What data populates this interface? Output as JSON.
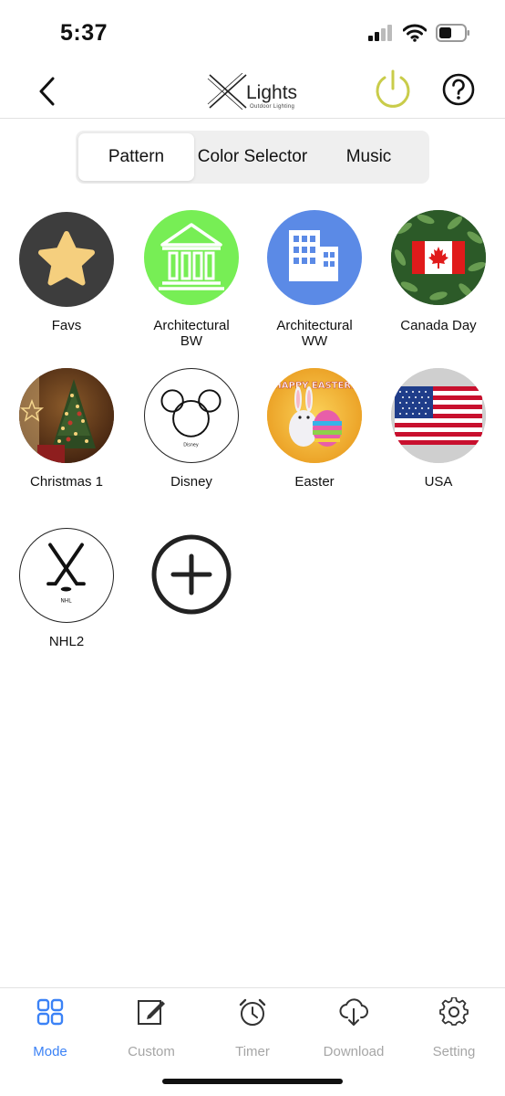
{
  "status_bar": {
    "time": "5:37"
  },
  "header": {
    "logo_text": "Lights",
    "logo_subtext": "Outdoor Lighting",
    "power_color": "#c9cc4a"
  },
  "segments": [
    {
      "label": "Pattern",
      "active": true
    },
    {
      "label": "Color Selector",
      "active": false
    },
    {
      "label": "Music",
      "active": false
    }
  ],
  "patterns": [
    {
      "label": "Favs",
      "icon": "star-icon"
    },
    {
      "label": "Architectural\nBW",
      "icon": "building-bw-icon"
    },
    {
      "label": "Architectural\nWW",
      "icon": "building-ww-icon"
    },
    {
      "label": "Canada Day",
      "icon": "canada-flag-icon"
    },
    {
      "label": "Christmas 1",
      "icon": "christmas-tree-icon"
    },
    {
      "label": "Disney",
      "icon": "disney-mouse-icon",
      "sublabel": "Disney"
    },
    {
      "label": "Easter",
      "icon": "easter-bunny-icon",
      "badge": "HAPPY EASTER!"
    },
    {
      "label": "USA",
      "icon": "usa-flag-icon"
    },
    {
      "label": "NHL2",
      "icon": "hockey-sticks-icon",
      "sublabel": "NHL"
    }
  ],
  "add_pattern": {
    "icon": "plus-icon"
  },
  "tabs": [
    {
      "label": "Mode",
      "icon": "grid-icon",
      "active": true
    },
    {
      "label": "Custom",
      "icon": "edit-icon",
      "active": false
    },
    {
      "label": "Timer",
      "icon": "alarm-clock-icon",
      "active": false
    },
    {
      "label": "Download",
      "icon": "cloud-download-icon",
      "active": false
    },
    {
      "label": "Setting",
      "icon": "gear-icon",
      "active": false
    }
  ],
  "colors": {
    "accent": "#3b82f6",
    "inactive": "#a6a6a6",
    "favs_bg": "#3d3d3d",
    "star": "#f5cf7e",
    "bw_bg": "#77ee55",
    "ww_bg": "#5b8ae6",
    "canada_red": "#e01b1b",
    "usa_red": "#c8102e",
    "usa_blue": "#1f3d8a"
  }
}
